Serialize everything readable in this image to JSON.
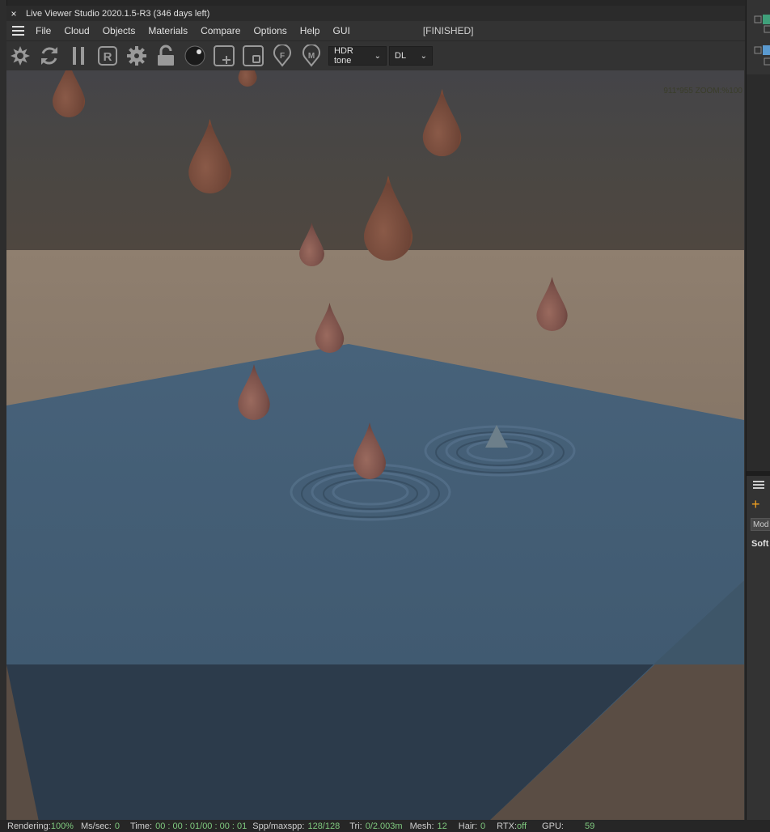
{
  "window": {
    "close_symbol": "×",
    "title": "Live Viewer Studio 2020.1.5-R3 (346 days left)"
  },
  "menu": {
    "items": [
      "File",
      "Cloud",
      "Objects",
      "Materials",
      "Compare",
      "Options",
      "Help",
      "GUI"
    ],
    "status": "[FINISHED]"
  },
  "toolbar": {
    "icons": [
      "aperture-icon",
      "refresh-icon",
      "pause-icon",
      "region-r-icon",
      "gear-icon",
      "lock-icon",
      "sphere-icon",
      "add-region-icon",
      "region-select-icon",
      "focus-pin-icon",
      "material-pin-icon"
    ],
    "tonemap_select": "HDR tone",
    "kernel_select": "DL"
  },
  "viewport": {
    "zoom_label": "911*955 ZOOM:%100"
  },
  "statusbar": {
    "rendering_label": "Rendering:",
    "rendering_value": "100%",
    "ms_label": "Ms/sec:",
    "ms_value": "0",
    "time_label": "Time:",
    "time_value": "00 : 00 : 01/00 : 00 : 01",
    "spp_label": "Spp/maxspp:",
    "spp_value": "128/128",
    "tri_label": "Tri:",
    "tri_value": "0/2.003m",
    "mesh_label": "Mesh:",
    "mesh_value": "12",
    "hair_label": "Hair:",
    "hair_value": "0",
    "rtx_label": "RTX:",
    "rtx_value": "off",
    "gpu_label": "GPU:",
    "gpu_value": "59"
  },
  "right_panel": {
    "add_symbol": "+",
    "mode_label": "Mod",
    "soft_label": "Soft"
  },
  "colors": {
    "status_value": "#7fc97f",
    "plus_accent": "#f0a020"
  }
}
